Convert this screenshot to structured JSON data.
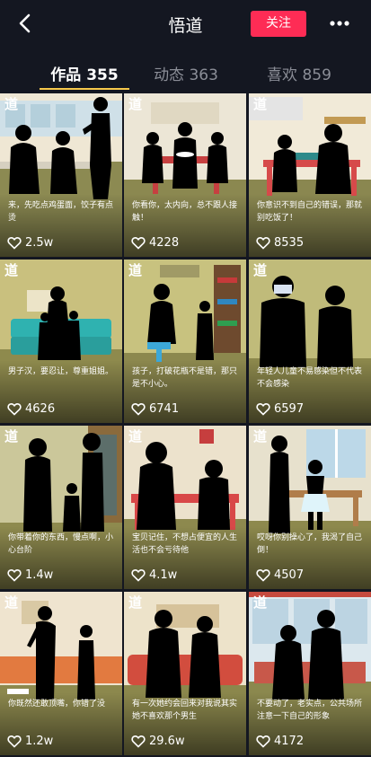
{
  "header": {
    "title": "悟道",
    "follow_label": "关注",
    "back_icon": "chevron-left-icon",
    "more_icon": "more-dots-icon"
  },
  "tabs": [
    {
      "label": "作品 355",
      "active": true
    },
    {
      "label": "动态 363",
      "active": false
    },
    {
      "label": "喜欢 859",
      "active": false
    }
  ],
  "colors": {
    "background": "#141721",
    "accent": "#fe2c55",
    "tab_underline": "#f7c94b",
    "tab_inactive": "#8b8e97"
  },
  "videos": [
    {
      "logo": "道",
      "caption": "来，先吃点鸡蛋面，饺子有点烫",
      "likes": "2.5w"
    },
    {
      "logo": "道",
      "caption": "你看你，太内向，总不跟人接触！",
      "likes": "4228"
    },
    {
      "logo": "道",
      "caption": "你意识不到自己的错误，那就别吃饭了！",
      "likes": "8535"
    },
    {
      "logo": "道",
      "caption": "男子汉，要忍让，尊重姐姐。",
      "likes": "4626"
    },
    {
      "logo": "道",
      "caption": "孩子，打破花瓶不是错，那只是不小心。",
      "likes": "6741"
    },
    {
      "logo": "道",
      "caption": "年轻人儿童不易感染但不代表不会感染",
      "likes": "6597"
    },
    {
      "logo": "道",
      "caption": "你带着你的东西，慢点啊，小心台阶",
      "likes": "1.4w"
    },
    {
      "logo": "道",
      "caption": "宝贝记住，不想占便宜的人生活也不会亏待他",
      "likes": "4.1w"
    },
    {
      "logo": "道",
      "caption": "哎呀你别操心了，我渴了自己倒！",
      "likes": "4507"
    },
    {
      "logo": "道",
      "caption": "你既然还敢顶嘴，你错了没",
      "likes": "1.2w"
    },
    {
      "logo": "道",
      "caption": "有一次她约会回来对我说其实她不喜欢那个男生",
      "likes": "29.6w"
    },
    {
      "logo": "道",
      "caption": "不要动了，老实点，公共场所注意一下自己的形象",
      "likes": "4172"
    }
  ]
}
